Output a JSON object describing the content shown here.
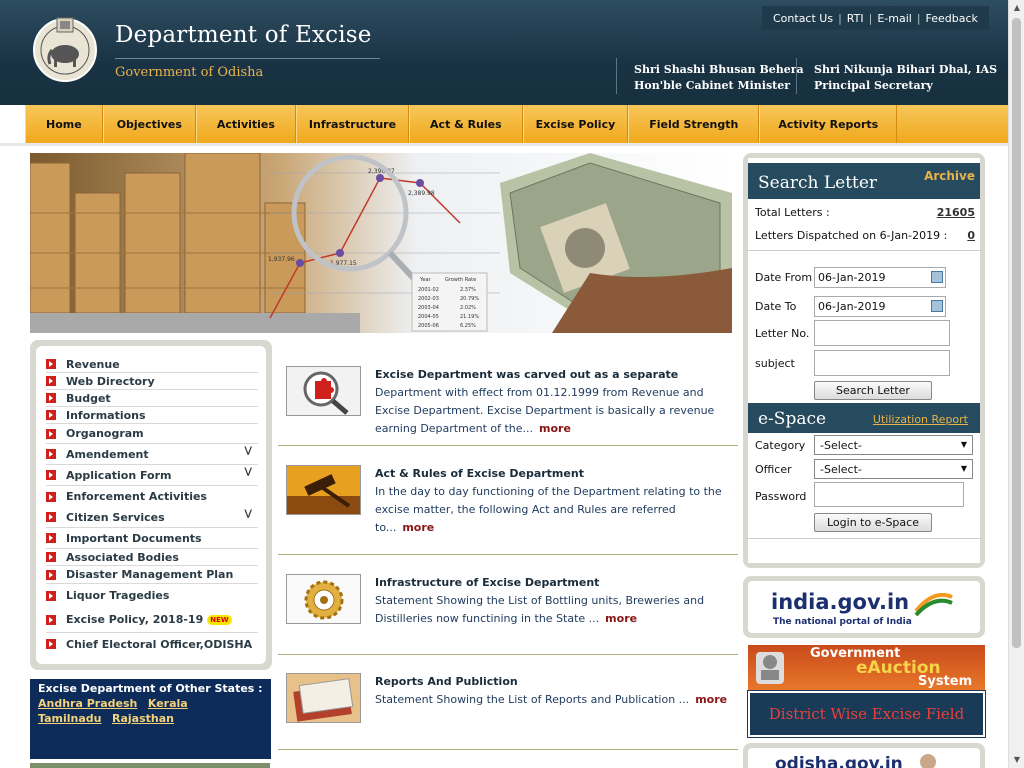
{
  "header": {
    "title": "Department of Excise",
    "subtitle": "Government of Odisha",
    "top_links": [
      "Contact Us",
      "RTI",
      "E-mail",
      "Feedback"
    ],
    "officials": [
      {
        "name": "Shri Shashi Bhusan Behera",
        "role": "Hon'ble Cabinet Minister"
      },
      {
        "name": "Shri Nikunja Bihari Dhal, IAS",
        "role": "Principal Secretary"
      }
    ]
  },
  "nav": [
    "Home",
    "Objectives",
    "Activities",
    "Infrastructure",
    "Act & Rules",
    "Excise Policy",
    "Field Strength",
    "Activity Reports"
  ],
  "banner": {
    "chart_labels": [
      "2,396.07",
      "2,389.98",
      "1,937.96",
      "1,977.15"
    ],
    "table_headers": [
      "Year",
      "Growth Rate"
    ],
    "table_rows": [
      [
        "2001-02",
        "2.37%"
      ],
      [
        "2002-03",
        "20.79%"
      ],
      [
        "2003-04",
        "2.02%"
      ],
      [
        "2004-05",
        "21.19%"
      ],
      [
        "2005-06",
        "6.25%"
      ]
    ]
  },
  "left_menu": [
    {
      "label": "Revenue",
      "expand": false
    },
    {
      "label": "Web Directory",
      "expand": false
    },
    {
      "label": "Budget",
      "expand": false
    },
    {
      "label": "Informations",
      "expand": false
    },
    {
      "label": "Organogram",
      "expand": false
    },
    {
      "label": "Amendement",
      "expand": true
    },
    {
      "label": "Application Form",
      "expand": true
    },
    {
      "label": "Enforcement Activities",
      "expand": false
    },
    {
      "label": "Citizen Services",
      "expand": true
    },
    {
      "label": "Important Documents",
      "expand": false
    },
    {
      "label": "Associated Bodies",
      "expand": false
    },
    {
      "label": "Disaster Management Plan",
      "expand": false
    },
    {
      "label": "Liquor Tragedies",
      "expand": false
    },
    {
      "label": "Excise Policy, 2018-19",
      "expand": false,
      "badge": "NEW"
    },
    {
      "label": "Chief Electoral Officer,ODISHA",
      "expand": false
    }
  ],
  "other_states": {
    "heading": "Excise Department of Other States :",
    "states": [
      "Andhra Pradesh",
      "Kerala",
      "Tamilnadu",
      "Rajasthan"
    ]
  },
  "news": [
    {
      "title": "Excise Department was carved out as a separate",
      "text": "Department with effect from 01.12.1999 from Revenue and Excise Department. Excise Department is basically a revenue earning Department of the...",
      "more": "more"
    },
    {
      "title": "Act & Rules of Excise Department",
      "text": "In the day to day functioning of the Department relating to the excise matter, the following Act and Rules are referred to...",
      "more": "more"
    },
    {
      "title": "Infrastructure of Excise Department",
      "text": "Statement Showing the List of Bottling units, Breweries and Distilleries now functining in the State ...",
      "more": "more"
    },
    {
      "title": "Reports And Publiction",
      "text": "Statement Showing the List of Reports and Publication ...",
      "more": "more"
    }
  ],
  "search_letter": {
    "heading": "Search Letter",
    "archive": "Archive",
    "total_label": "Total Letters :",
    "total_value": "21605",
    "dispatched_label": "Letters Dispatched on 6-Jan-2019 :",
    "dispatched_value": "0",
    "date_from_label": "Date From",
    "date_from_value": "06-Jan-2019",
    "date_to_label": "Date To",
    "date_to_value": "06-Jan-2019",
    "letter_no_label": "Letter No.",
    "subject_label": "subject",
    "button": "Search Letter"
  },
  "espace": {
    "heading": "e-Space",
    "report_link": "Utilization Report",
    "category_label": "Category",
    "category_value": "-Select-",
    "officer_label": "Officer",
    "officer_value": "-Select-",
    "password_label": "Password",
    "button": "Login to e-Space"
  },
  "logos": {
    "india_gov_main": "india.gov.in",
    "india_gov_tag": "The national portal of India",
    "eauction_l1": "Government",
    "eauction_l2": "eAuction",
    "eauction_l3": "System",
    "district_field": "District Wise Excise Field",
    "odisha_gov": "odisha.gov.in"
  },
  "colors": {
    "header_bg": "#1a3344",
    "nav_bg": "#f0a81c",
    "panel_head": "#264a5e",
    "more_link": "#8b1414",
    "bullet": "#d0201e"
  }
}
